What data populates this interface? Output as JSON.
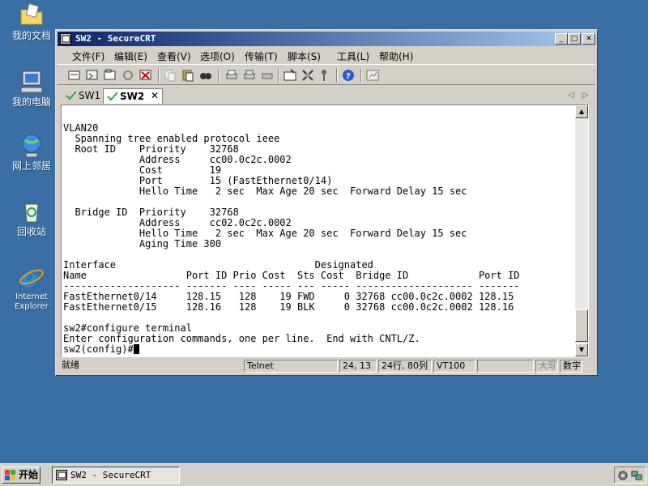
{
  "desktop": {
    "icons": [
      {
        "label": "我的文档"
      },
      {
        "label": "我的电脑"
      },
      {
        "label": "网上邻居"
      },
      {
        "label": "回收站"
      },
      {
        "label": "Internet Explorer"
      }
    ]
  },
  "window": {
    "title": "SW2 - SecureCRT",
    "controls": {
      "minimize": "_",
      "maximize": "□",
      "close": "✕"
    },
    "menu": [
      "文件(F)",
      "编辑(E)",
      "查看(V)",
      "选项(O)",
      "传输(T)",
      "脚本(S)",
      "工具(L)",
      "帮助(H)"
    ],
    "tabs": [
      {
        "label": "SW1",
        "active": false
      },
      {
        "label": "SW2",
        "active": true,
        "close": "✕"
      }
    ],
    "tab_nav": {
      "prev": "◁",
      "next": "▷"
    }
  },
  "terminal": {
    "lines": [
      "VLAN20",
      "  Spanning tree enabled protocol ieee",
      "  Root ID    Priority    32768",
      "             Address     cc00.0c2c.0002",
      "             Cost        19",
      "             Port        15 (FastEthernet0/14)",
      "             Hello Time   2 sec  Max Age 20 sec  Forward Delay 15 sec",
      "",
      "  Bridge ID  Priority    32768",
      "             Address     cc02.0c2c.0002",
      "             Hello Time   2 sec  Max Age 20 sec  Forward Delay 15 sec",
      "             Aging Time 300",
      "",
      "Interface                                  Designated",
      "Name                 Port ID Prio Cost  Sts Cost  Bridge ID            Port ID",
      "-------------------- ------- ---- ----- --- ----- -------------------- -------",
      "FastEthernet0/14     128.15   128    19 FWD     0 32768 cc00.0c2c.0002 128.15",
      "FastEthernet0/15     128.16   128    19 BLK     0 32768 cc00.0c2c.0002 128.16",
      "",
      "sw2#configure terminal",
      "Enter configuration commands, one per line.  End with CNTL/Z.",
      "sw2(config)#"
    ]
  },
  "statusbar": {
    "ready": "就绪",
    "protocol": "Telnet",
    "position": "24, 13",
    "size": "24行, 80列",
    "emulation": "VT100",
    "blank": "",
    "caps": "大写",
    "num": "数字"
  },
  "taskbar": {
    "start_label": "开始",
    "task_label": "SW2 - SecureCRT"
  },
  "colors": {
    "desktop": "#3a6ea5",
    "titlebar_start": "#0a246a",
    "titlebar_end": "#a6caf0",
    "chrome": "#d4d0c8"
  }
}
